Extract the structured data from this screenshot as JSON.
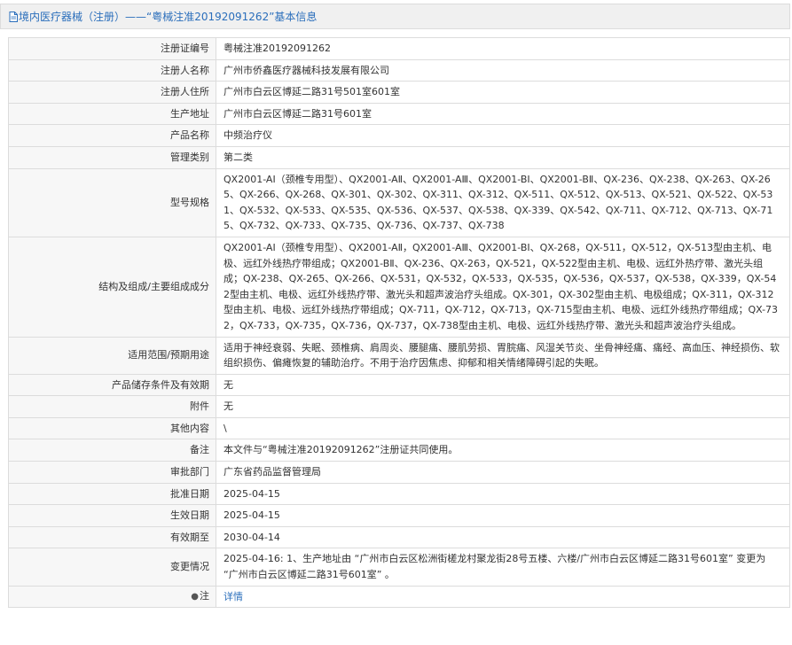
{
  "header": {
    "title": "境内医疗器械（注册）——“粤械注准20192091262”基本信息",
    "icon": "document-icon"
  },
  "rows": {
    "reg_no": {
      "label": "注册证编号",
      "value": "粤械注准20192091262"
    },
    "registrant_name": {
      "label": "注册人名称",
      "value": "广州市侨鑫医疗器械科技发展有限公司"
    },
    "registrant_address": {
      "label": "注册人住所",
      "value": "广州市白云区博延二路31号501室601室"
    },
    "production_address": {
      "label": "生产地址",
      "value": "广州市白云区博延二路31号601室"
    },
    "product_name": {
      "label": "产品名称",
      "value": "中频治疗仪"
    },
    "management_class": {
      "label": "管理类别",
      "value": "第二类"
    },
    "model_spec": {
      "label": "型号规格",
      "value": "QX2001-AI（颈椎专用型）、QX2001-AⅡ、QX2001-AⅢ、QX2001-BⅠ、QX2001-BⅡ、QX-236、QX-238、QX-263、QX-265、QX-266、QX-268、QX-301、QX-302、QX-311、QX-312、QX-511、QX-512、QX-513、QX-521、QX-522、QX-531、QX-532、QX-533、QX-535、QX-536、QX-537、QX-538、QX-339、QX-542、QX-711、QX-712、QX-713、QX-715、QX-732、QX-733、QX-735、QX-736、QX-737、QX-738"
    },
    "structure": {
      "label": "结构及组成/主要组成成分",
      "value": "QX2001-AI（颈椎专用型）、QX2001-AⅡ，QX2001-AⅢ、QX2001-BⅠ、QX-268，QX-511，QX-512，QX-513型由主机、电极、远红外线热疗带组成；QX2001-BⅡ、QX-236、QX-263，QX-521，QX-522型由主机、电极、远红外热疗带、激光头组成；QX-238、QX-265、QX-266、QX-531，QX-532，QX-533，QX-535，QX-536，QX-537，QX-538，QX-339，QX-542型由主机、电极、远红外线热疗带、激光头和超声波治疗头组成。QX-301，QX-302型由主机、电极组成；QX-311，QX-312型由主机、电极、远红外线热疗带组成；QX-711，QX-712，QX-713，QX-715型由主机、电极、远红外线热疗带组成；QX-732，QX-733，QX-735，QX-736，QX-737，QX-738型由主机、电极、远红外线热疗带、激光头和超声波治疗头组成。"
    },
    "scope": {
      "label": "适用范围/预期用途",
      "value": "适用于神经衰弱、失眠、颈椎病、肩周炎、腰腿痛、腰肌劳损、胃脘痛、风湿关节炎、坐骨神经痛、痛经、高血压、神经损伤、软组织损伤、偏瘫恢复的辅助治疗。不用于治疗因焦虑、抑郁和相关情绪障碍引起的失眠。"
    },
    "storage": {
      "label": "产品储存条件及有效期",
      "value": "无"
    },
    "accessories": {
      "label": "附件",
      "value": "无"
    },
    "other": {
      "label": "其他内容",
      "value": "\\"
    },
    "remark": {
      "label": "备注",
      "value": "本文件与“粤械注准20192091262”注册证共同使用。"
    },
    "approval_dept": {
      "label": "审批部门",
      "value": "广东省药品监督管理局"
    },
    "approval_date": {
      "label": "批准日期",
      "value": "2025-04-15"
    },
    "effective_date": {
      "label": "生效日期",
      "value": "2025-04-15"
    },
    "expiry_date": {
      "label": "有效期至",
      "value": "2030-04-14"
    },
    "changes": {
      "label": "变更情况",
      "value": "2025-04-16: 1、生产地址由 “广州市白云区松洲街槎龙村聚龙街28号五楼、六楼/广州市白云区博延二路31号601室” 变更为 “广州市白云区博延二路31号601室” 。"
    },
    "note": {
      "label": "注",
      "value": "详情",
      "icon": "pin-icon"
    }
  }
}
